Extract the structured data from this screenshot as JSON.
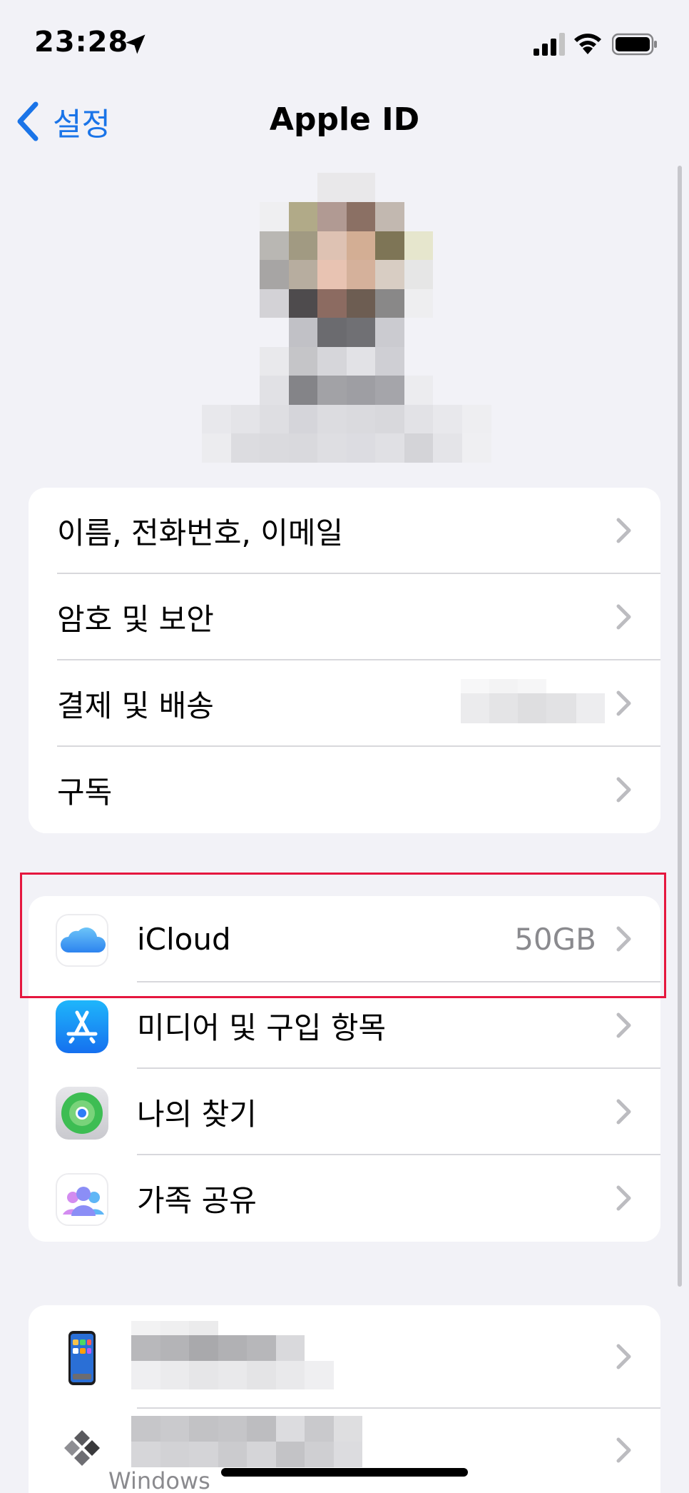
{
  "status_bar": {
    "time": "23:28"
  },
  "nav": {
    "back_label": "설정",
    "title": "Apple ID"
  },
  "account_rows": [
    {
      "label": "이름, 전화번호, 이메일"
    },
    {
      "label": "암호 및 보안"
    },
    {
      "label": "결제 및 배송"
    },
    {
      "label": "구독"
    }
  ],
  "service_rows": [
    {
      "label": "iCloud",
      "value": "50GB",
      "icon": "icloud-icon"
    },
    {
      "label": "미디어 및 구입 항목",
      "icon": "app-store-icon"
    },
    {
      "label": "나의 찾기",
      "icon": "find-my-icon"
    },
    {
      "label": "가족 공유",
      "icon": "family-sharing-icon"
    }
  ],
  "devices": [
    {
      "icon": "iphone-icon"
    },
    {
      "icon": "windows-device-icon",
      "sublabel": "Windows"
    }
  ],
  "colors": {
    "accent": "#1a74e8",
    "highlight": "#e5173f",
    "background": "#f2f2f7"
  }
}
